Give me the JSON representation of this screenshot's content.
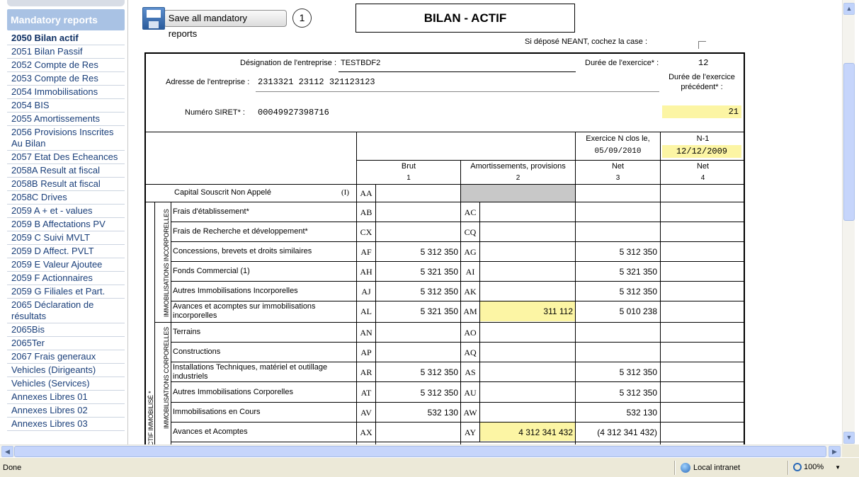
{
  "sidebar": {
    "header": "Mandatory reports",
    "items": [
      "2050 Bilan actif",
      "2051 Bilan Passif",
      "2052 Compte de Res",
      "2053 Compte de Res",
      "2054 Immobilisations",
      "2054 BIS",
      "2055 Amortissements",
      "2056 Provisions Inscrites Au Bilan",
      "2057 Etat Des Echeances",
      "2058A Result at fiscal",
      "2058B Result at fiscal",
      "2058C Drives",
      "2059 A + et - values",
      "2059 B Affectations PV",
      "2059 C Suivi MVLT",
      "2059 D Affect. PVLT",
      "2059 E Valeur Ajoutee",
      "2059 F Actionnaires",
      "2059 G Filiales et Part.",
      "2065 Déclaration de résultats",
      "2065Bis",
      "2065Ter",
      "2067 Frais generaux",
      "Vehicles (Dirigeants)",
      "Vehicles (Services)",
      "Annexes Libres 01",
      "Annexes Libres 02",
      "Annexes Libres 03"
    ]
  },
  "toolbar": {
    "save_label": "Save all mandatory reports",
    "step": "1"
  },
  "form": {
    "title": "BILAN - ACTIF",
    "neant_label": "Si déposé NEANT, cochez la case :",
    "designation_label": "Désignation de l'entreprise :",
    "designation_value": "TESTBDF2",
    "adresse_label": "Adresse de l'entreprise :",
    "adresse_value": "2313321 23112 321123123",
    "siret_label": "Numéro SIRET* :",
    "siret_value": "00049927398716",
    "duree_label": "Durée de l'exercice* :",
    "duree_value": "12",
    "duree_prec_label": "Durée de l'exercice précédent* :",
    "duree_prec_value": "21",
    "exercice_label": "Exercice N clos le,",
    "exercice_date": "05/09/2010",
    "n1_label": "N-1",
    "n1_date": "12/12/2009",
    "col1": {
      "name": "Brut",
      "num": "1"
    },
    "col2": {
      "name": "Amortissements, provisions",
      "num": "2"
    },
    "col3": {
      "name": "Net",
      "num": "3"
    },
    "col4": {
      "name": "Net",
      "num": "4"
    },
    "group1_label": "IMMOBILISATIONS INCORPORELLES",
    "group2_label": "IMMOBILISATIONS CORPORELLES",
    "group_outer_label": "ACTIF IMMOBILISÉ *",
    "capital_row": {
      "label": "Capital Souscrit Non Appelé",
      "note": "(I)",
      "code": "AA"
    },
    "rows": [
      {
        "label": "Frais d'établissement*",
        "code1": "AB",
        "brut": "",
        "code2": "AC",
        "amort": "",
        "net": ""
      },
      {
        "label": "Frais de Recherche et développement*",
        "code1": "CX",
        "brut": "",
        "code2": "CQ",
        "amort": "",
        "net": ""
      },
      {
        "label": "Concessions, brevets et droits similaires",
        "code1": "AF",
        "brut": "5 312 350",
        "code2": "AG",
        "amort": "",
        "net": "5 312 350"
      },
      {
        "label": "Fonds Commercial (1)",
        "code1": "AH",
        "brut": "5 321 350",
        "code2": "AI",
        "amort": "",
        "net": "5 321 350"
      },
      {
        "label": "Autres Immobilisations Incorporelles",
        "code1": "AJ",
        "brut": "5 312 350",
        "code2": "AK",
        "amort": "",
        "net": "5 312 350"
      },
      {
        "label": "Avances et acomptes sur immobilisations incorporelles",
        "code1": "AL",
        "brut": "5 321 350",
        "code2": "AM",
        "amort": "311 112",
        "net": "5 010 238"
      },
      {
        "label": "Terrains",
        "code1": "AN",
        "brut": "",
        "code2": "AO",
        "amort": "",
        "net": ""
      },
      {
        "label": "Constructions",
        "code1": "AP",
        "brut": "",
        "code2": "AQ",
        "amort": "",
        "net": ""
      },
      {
        "label": "Installations Techniques, matériel et outillage industriels",
        "code1": "AR",
        "brut": "5 312 350",
        "code2": "AS",
        "amort": "",
        "net": "5 312 350"
      },
      {
        "label": "Autres Immobilisations Corporelles",
        "code1": "AT",
        "brut": "5 312 350",
        "code2": "AU",
        "amort": "",
        "net": "5 312 350"
      },
      {
        "label": "Immobilisations en Cours",
        "code1": "AV",
        "brut": "532 130",
        "code2": "AW",
        "amort": "",
        "net": "532 130"
      },
      {
        "label": "Avances et Acomptes",
        "code1": "AX",
        "brut": "",
        "code2": "AY",
        "amort": "4 312 341 432",
        "net": "(4 312 341 432)"
      }
    ]
  },
  "status": {
    "text": "Done",
    "zone": "Local intranet",
    "zoom": "100%"
  },
  "colors": {
    "highlight": "#fcf5a4",
    "sidebar_header": "#a9c2e4"
  }
}
